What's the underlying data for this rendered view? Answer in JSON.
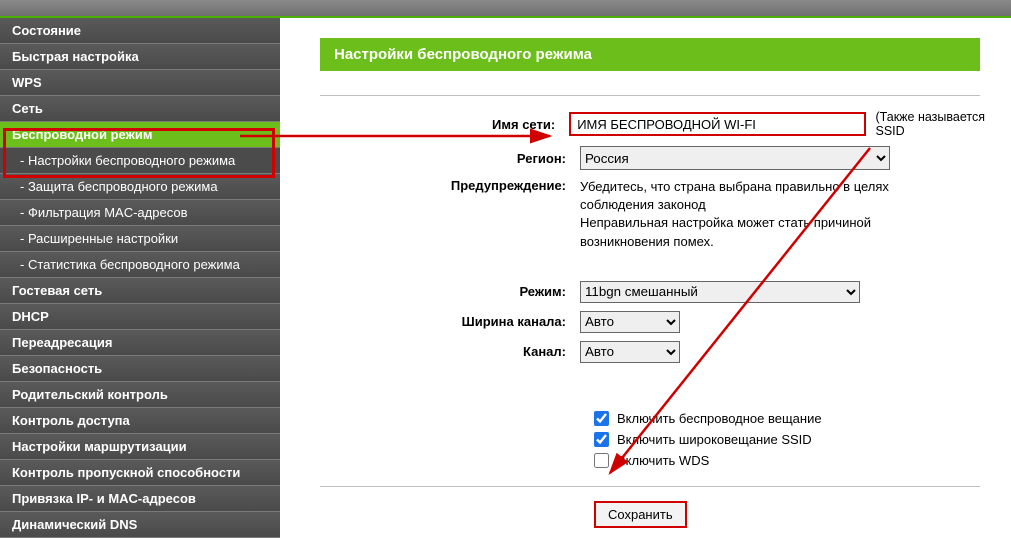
{
  "sidebar": {
    "items": [
      {
        "label": "Состояние"
      },
      {
        "label": "Быстрая настройка"
      },
      {
        "label": "WPS"
      },
      {
        "label": "Сеть"
      },
      {
        "label": "Беспроводной режим",
        "active": true
      },
      {
        "label": "- Настройки беспроводного режима",
        "sub": true,
        "subactive": true
      },
      {
        "label": "- Защита беспроводного режима",
        "sub": true
      },
      {
        "label": "- Фильтрация MAC-адресов",
        "sub": true
      },
      {
        "label": "- Расширенные настройки",
        "sub": true
      },
      {
        "label": "- Статистика беспроводного режима",
        "sub": true
      },
      {
        "label": "Гостевая сеть"
      },
      {
        "label": "DHCP"
      },
      {
        "label": "Переадресация"
      },
      {
        "label": "Безопасность"
      },
      {
        "label": "Родительский контроль"
      },
      {
        "label": "Контроль доступа"
      },
      {
        "label": "Настройки маршрутизации"
      },
      {
        "label": "Контроль пропускной способности"
      },
      {
        "label": "Привязка IP- и MAC-адресов"
      },
      {
        "label": "Динамический DNS"
      }
    ]
  },
  "panel": {
    "title": "Настройки беспроводного режима"
  },
  "form": {
    "ssid_label": "Имя сети:",
    "ssid_value": "ИМЯ БЕСПРОВОДНОЙ WI-FI",
    "ssid_hint": "(Также называется SSID",
    "region_label": "Регион:",
    "region_value": "Россия",
    "warning_label": "Предупреждение:",
    "warning_text1": "Убедитесь, что страна выбрана правильно в целях соблюдения законод",
    "warning_text2": "Неправильная настройка может стать причиной возникновения помех.",
    "mode_label": "Режим:",
    "mode_value": "11bgn смешанный",
    "width_label": "Ширина канала:",
    "width_value": "Авто",
    "channel_label": "Канал:",
    "channel_value": "Авто",
    "cb_broadcast": "Включить беспроводное вещание",
    "cb_ssid": "Включить широковещание SSID",
    "cb_wds": "Включить WDS",
    "save": "Сохранить"
  }
}
